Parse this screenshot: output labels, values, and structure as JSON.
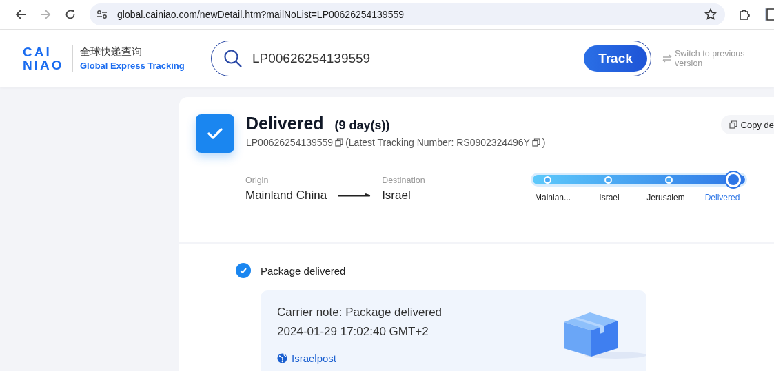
{
  "browser": {
    "url": "global.cainiao.com/newDetail.htm?mailNoList=LP00626254139559",
    "forward_disabled": true
  },
  "header": {
    "logo_top": "CAI",
    "logo_bottom": "NIAO",
    "brand_cn": "全球快递查询",
    "brand_en": "Global Express Tracking",
    "search_value": "LP00626254139559",
    "search_button": "Track",
    "switch_link": "Switch to previous version"
  },
  "summary": {
    "status": "Delivered",
    "duration": "(9 day(s))",
    "tracking_number": "LP00626254139559",
    "latest_tracking": "(Latest Tracking Number: RS0902324496Y",
    "latest_close": ")",
    "copy_button": "Copy de",
    "origin_label": "Origin",
    "origin": "Mainland China",
    "destination_label": "Destination",
    "destination": "Israel",
    "progress": [
      {
        "label": "Mainlan...",
        "current": false
      },
      {
        "label": "Israel",
        "current": false
      },
      {
        "label": "Jerusalem",
        "current": false
      },
      {
        "label": "Delivered",
        "current": true
      }
    ]
  },
  "events": [
    {
      "title": "Package delivered",
      "note": "Carrier note: Package delivered",
      "time": "2024-01-29 17:02:40 GMT+2",
      "carrier": "Israelpost"
    }
  ]
}
